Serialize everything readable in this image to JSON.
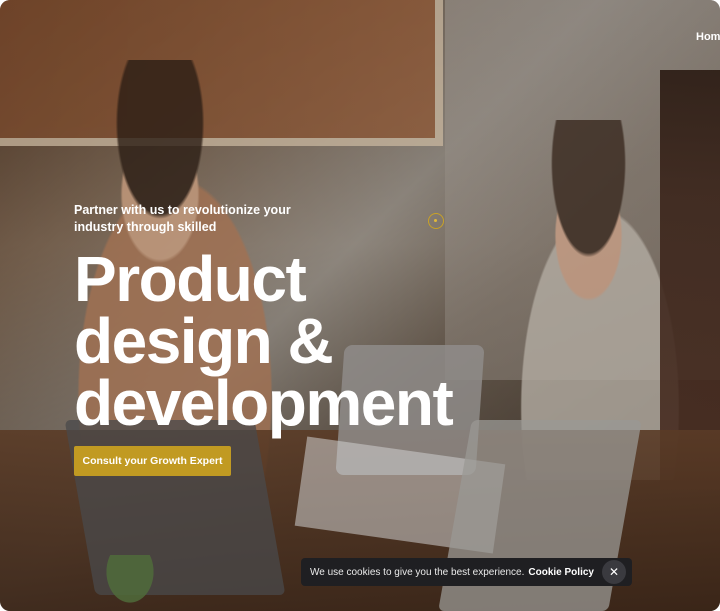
{
  "nav": {
    "home_label": "Home"
  },
  "hero": {
    "tagline": "Partner with us to revolutionize your industry through skilled",
    "headline": [
      "Product",
      "design &",
      "development"
    ],
    "cta_label": "Consult your Growth Expert"
  },
  "cookie_banner": {
    "message": "We use cookies to give you the best experience.",
    "policy_link": "Cookie Policy",
    "close_icon": "close-icon",
    "close_glyph": "✕"
  },
  "colors": {
    "accent": "#c19a22",
    "banner_bg": "#1f1f22"
  }
}
